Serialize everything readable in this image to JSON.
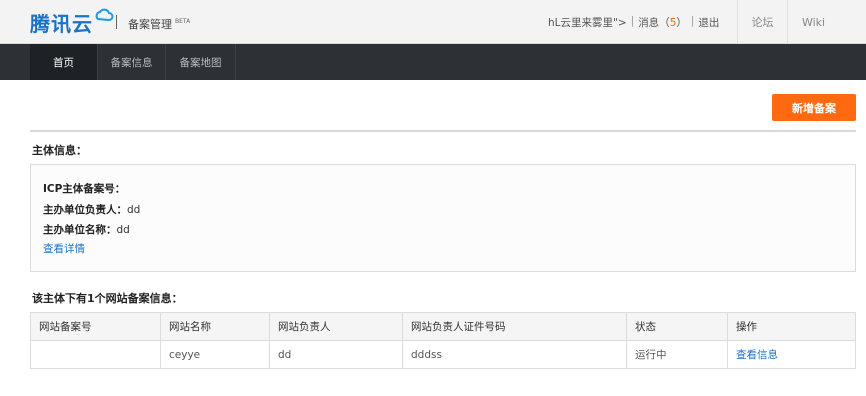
{
  "header": {
    "logo": "腾讯云",
    "brand": "备案管理",
    "badge": "BETA",
    "user": "hL云里来雾里\">",
    "messages_label": "消息（",
    "messages_count": "5",
    "messages_close": "）",
    "logout": "退出",
    "forum": "论坛",
    "wiki": "Wiki"
  },
  "nav": {
    "items": [
      {
        "label": "首页"
      },
      {
        "label": "备案信息"
      },
      {
        "label": "备案地图"
      }
    ]
  },
  "actions": {
    "new_filing": "新增备案"
  },
  "subject": {
    "title": "主体信息：",
    "icp_label": "ICP主体备案号：",
    "icp_value": "",
    "owner_label": "主办单位负责人：",
    "owner_value": "dd",
    "org_label": "主办单位名称：",
    "org_value": "dd",
    "details_link": "查看详情"
  },
  "sites": {
    "title": "该主体下有1个网站备案信息：",
    "columns": [
      "网站备案号",
      "网站名称",
      "网站负责人",
      "网站负责人证件号码",
      "状态",
      "操作"
    ],
    "rows": [
      {
        "record_no": "",
        "name": "ceyye",
        "owner": "dd",
        "id_no": "dddss",
        "status": "运行中",
        "action": "查看信息"
      }
    ]
  },
  "colors": {
    "accent": "#ff6a10",
    "link": "#1a73c8",
    "nav_bg": "#2d3136",
    "header_bg": "#f3f3f3"
  }
}
